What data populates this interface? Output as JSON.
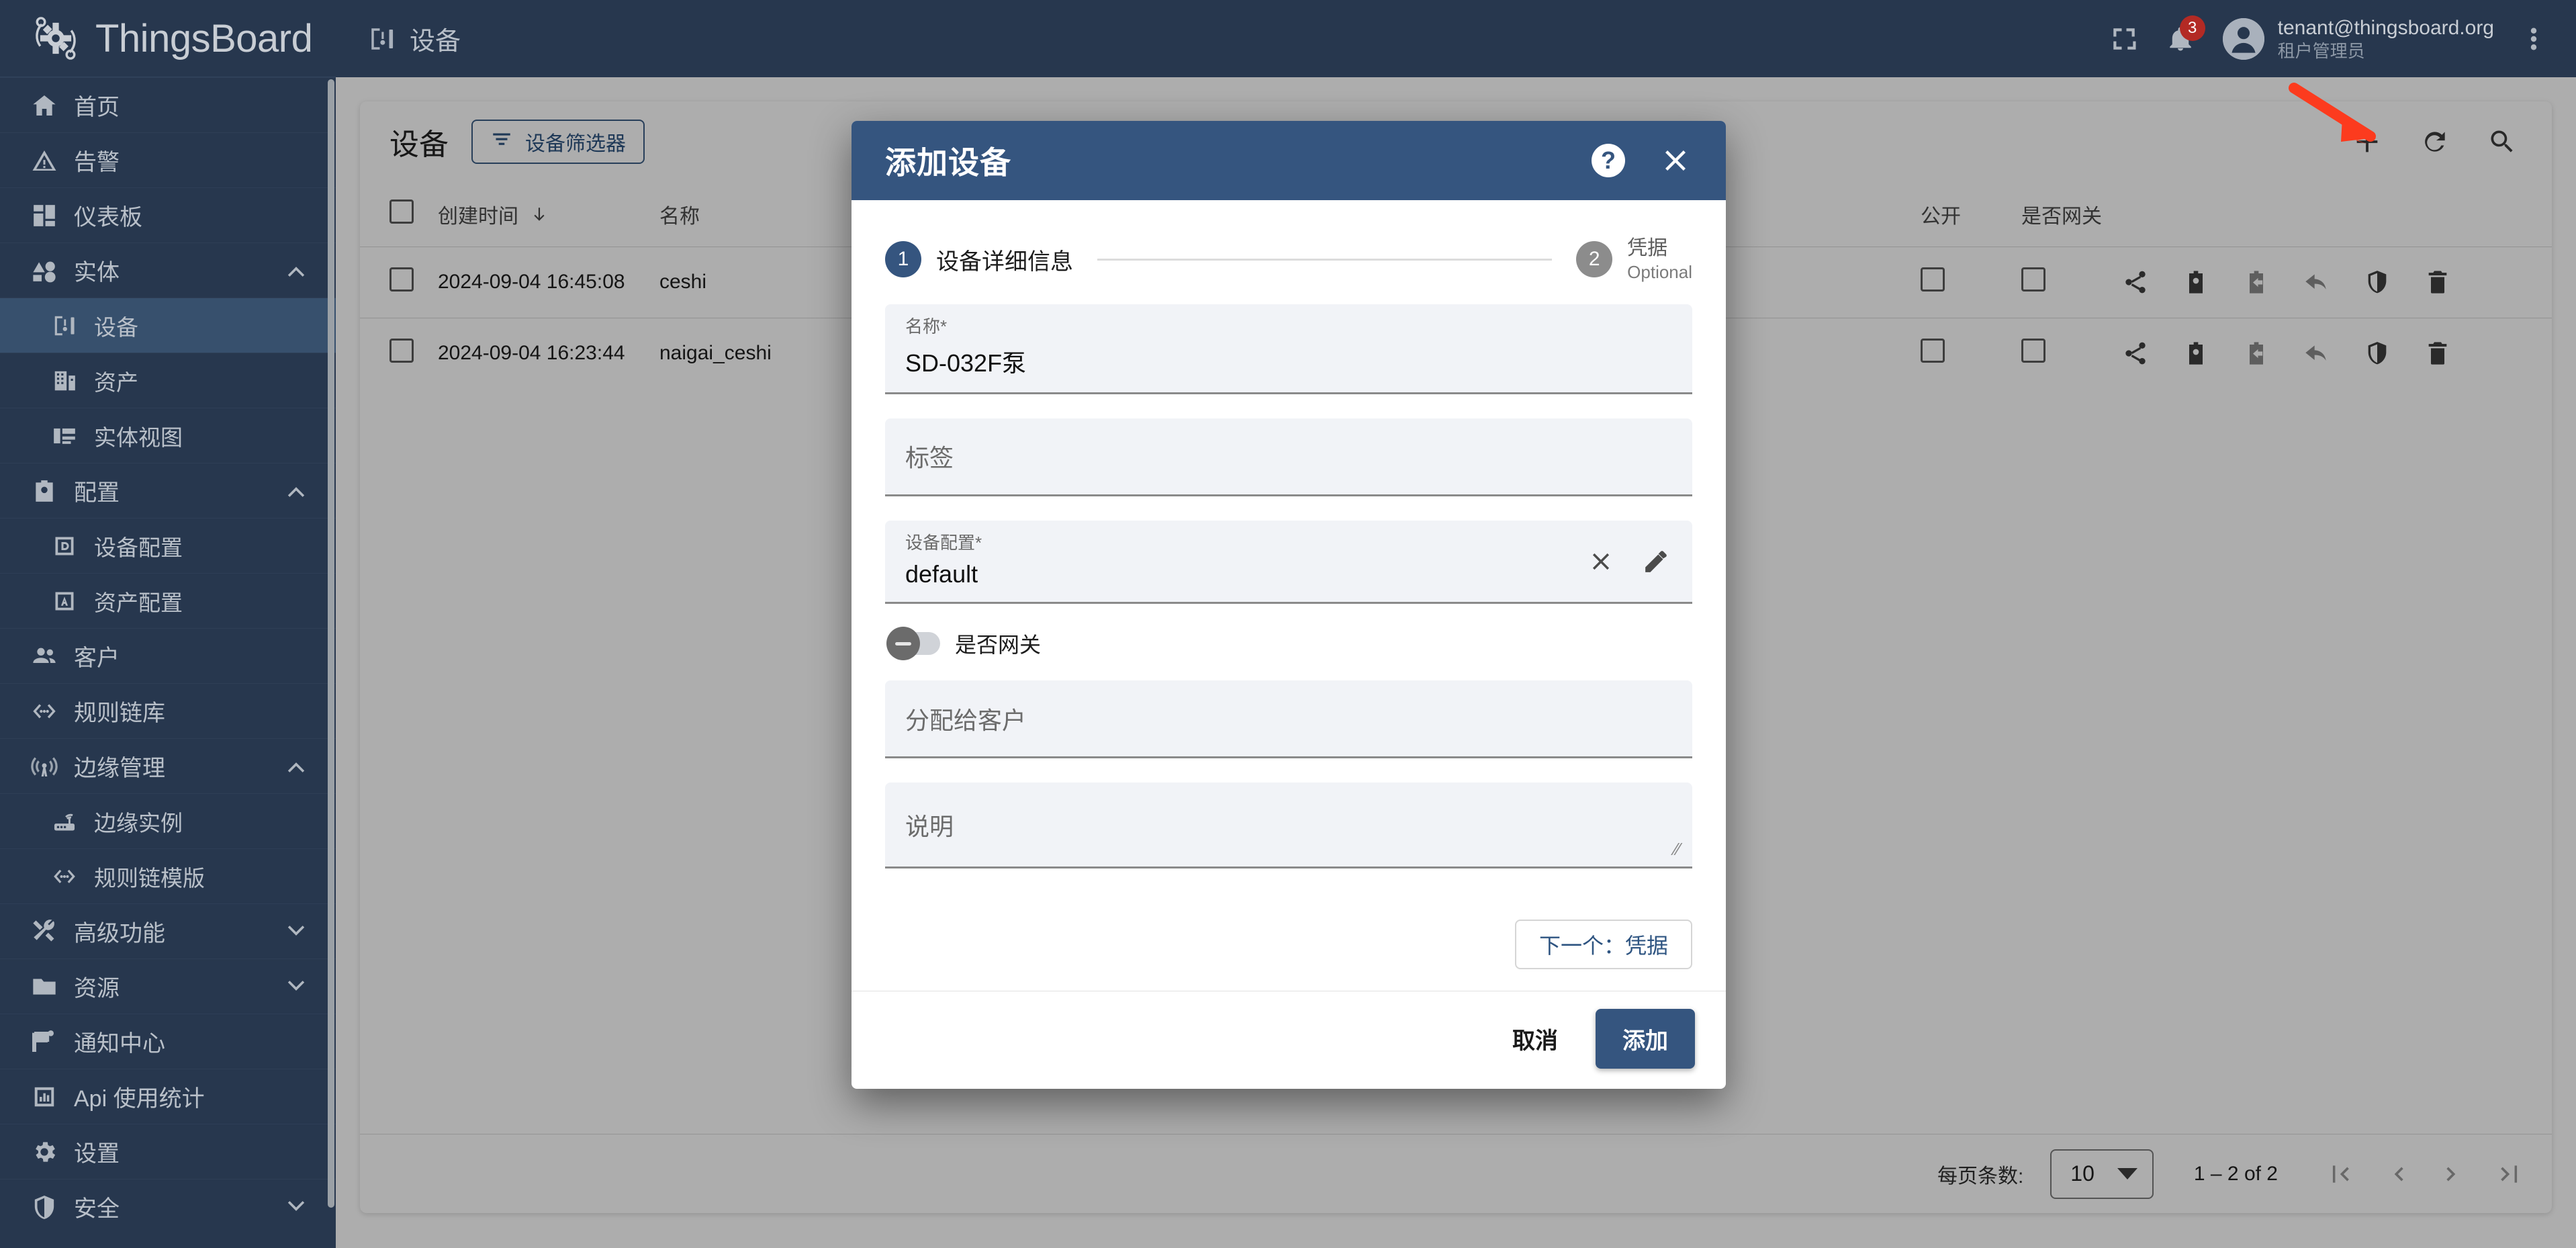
{
  "brand": {
    "name": "ThingsBoard",
    "logo_icon": "thingsboard-logo-icon"
  },
  "sidebar": {
    "items": [
      {
        "label": "首页",
        "icon": "home-icon",
        "level": 0,
        "chevron": "",
        "active": false
      },
      {
        "label": "告警",
        "icon": "alarm-triangle-icon",
        "level": 0,
        "chevron": "",
        "active": false
      },
      {
        "label": "仪表板",
        "icon": "dashboard-icon",
        "level": 0,
        "chevron": "",
        "active": false
      },
      {
        "label": "实体",
        "icon": "entity-icon",
        "level": 0,
        "chevron": "up",
        "active": false
      },
      {
        "label": "设备",
        "icon": "device-icon",
        "level": 1,
        "chevron": "",
        "active": true
      },
      {
        "label": "资产",
        "icon": "asset-building-icon",
        "level": 1,
        "chevron": "",
        "active": false
      },
      {
        "label": "实体视图",
        "icon": "entity-view-icon",
        "level": 1,
        "chevron": "",
        "active": false
      },
      {
        "label": "配置",
        "icon": "profile-card-icon",
        "level": 0,
        "chevron": "up",
        "active": false
      },
      {
        "label": "设备配置",
        "icon": "device-profile-icon",
        "level": 1,
        "chevron": "",
        "active": false
      },
      {
        "label": "资产配置",
        "icon": "asset-profile-icon",
        "level": 1,
        "chevron": "",
        "active": false
      },
      {
        "label": "客户",
        "icon": "customers-icon",
        "level": 0,
        "chevron": "",
        "active": false
      },
      {
        "label": "规则链库",
        "icon": "rule-chain-icon",
        "level": 0,
        "chevron": "",
        "active": false
      },
      {
        "label": "边缘管理",
        "icon": "edge-signal-icon",
        "level": 0,
        "chevron": "up",
        "active": false
      },
      {
        "label": "边缘实例",
        "icon": "router-icon",
        "level": 1,
        "chevron": "",
        "active": false
      },
      {
        "label": "规则链模版",
        "icon": "rule-chain-icon",
        "level": 1,
        "chevron": "",
        "active": false
      },
      {
        "label": "高级功能",
        "icon": "tools-icon",
        "level": 0,
        "chevron": "down",
        "active": false
      },
      {
        "label": "资源",
        "icon": "folder-icon",
        "level": 0,
        "chevron": "down",
        "active": false
      },
      {
        "label": "通知中心",
        "icon": "flag-icon",
        "level": 0,
        "chevron": "",
        "active": false
      },
      {
        "label": "Api 使用统计",
        "icon": "bar-chart-icon",
        "level": 0,
        "chevron": "",
        "active": false
      },
      {
        "label": "设置",
        "icon": "gear-icon",
        "level": 0,
        "chevron": "",
        "active": false
      },
      {
        "label": "安全",
        "icon": "shield-icon",
        "level": 0,
        "chevron": "down",
        "active": false
      }
    ]
  },
  "topbar": {
    "title": "设备",
    "page_icon": "device-icon",
    "fullscreen_icon": "fullscreen-icon",
    "notifications_icon": "bell-icon",
    "notifications_count": "3",
    "user_email": "tenant@thingsboard.org",
    "user_role": "租户管理员",
    "more_icon": "more-vertical-icon"
  },
  "table_page": {
    "title": "设备",
    "filter_button": "设备筛选器",
    "filter_icon": "filter-icon",
    "actions": [
      {
        "name": "add-device-button",
        "icon": "plus-icon"
      },
      {
        "name": "refresh-button",
        "icon": "refresh-icon"
      },
      {
        "name": "search-button",
        "icon": "search-icon"
      }
    ],
    "columns": [
      "创建时间",
      "名称",
      "公开",
      "是否网关"
    ],
    "sort_column": "创建时间",
    "sort_direction": "desc",
    "rows": [
      {
        "created_time": "2024-09-04 16:45:08",
        "name": "ceshi",
        "public": false,
        "gateway": false
      },
      {
        "created_time": "2024-09-04 16:23:44",
        "name": "naigai_ceshi",
        "public": false,
        "gateway": false
      }
    ],
    "row_action_icons": [
      "share-icon",
      "assign-to-customer-icon",
      "unassign-from-customer-icon",
      "reply-icon",
      "manage-credentials-icon",
      "delete-icon"
    ],
    "footer": {
      "per_page_label": "每页条数:",
      "per_page_value": "10",
      "range_label": "1 – 2 of 2",
      "pager_icons": [
        "first-page-icon",
        "prev-page-icon",
        "next-page-icon",
        "last-page-icon"
      ]
    }
  },
  "dialog": {
    "title": "添加设备",
    "help_icon": "help-icon",
    "close_icon": "close-icon",
    "steps": [
      {
        "number": "1",
        "label": "设备详细信息",
        "state": "active"
      },
      {
        "number": "2",
        "label": "凭据",
        "sub": "Optional",
        "state": "inactive"
      }
    ],
    "fields": [
      {
        "name": "device-name-field",
        "label": "名称*",
        "value": "SD-032F泵",
        "placeholder": ""
      },
      {
        "name": "device-label-field",
        "label": "",
        "value": "",
        "placeholder": "标签"
      },
      {
        "name": "device-profile-field",
        "label": "设备配置*",
        "value": "default",
        "placeholder": "",
        "actions": [
          "clear-icon",
          "edit-pencil-icon"
        ]
      },
      {
        "name": "assign-customer-field",
        "label": "",
        "value": "",
        "placeholder": "分配给客户"
      },
      {
        "name": "description-field",
        "label": "",
        "value": "",
        "placeholder": "说明",
        "resizable": true
      }
    ],
    "gateway_toggle": {
      "label": "是否网关",
      "checked": false
    },
    "next_button": "下一个：凭据",
    "cancel_button": "取消",
    "submit_button": "添加"
  },
  "annotation": {
    "arrow_color": "#fc3b1e",
    "points_to": "add-device-button"
  },
  "colors": {
    "sidebar_bg": "#27374e",
    "sidebar_active": "#37506d",
    "dialog_header": "#35557f",
    "primary": "#35557f",
    "badge_red": "#b32a24"
  }
}
